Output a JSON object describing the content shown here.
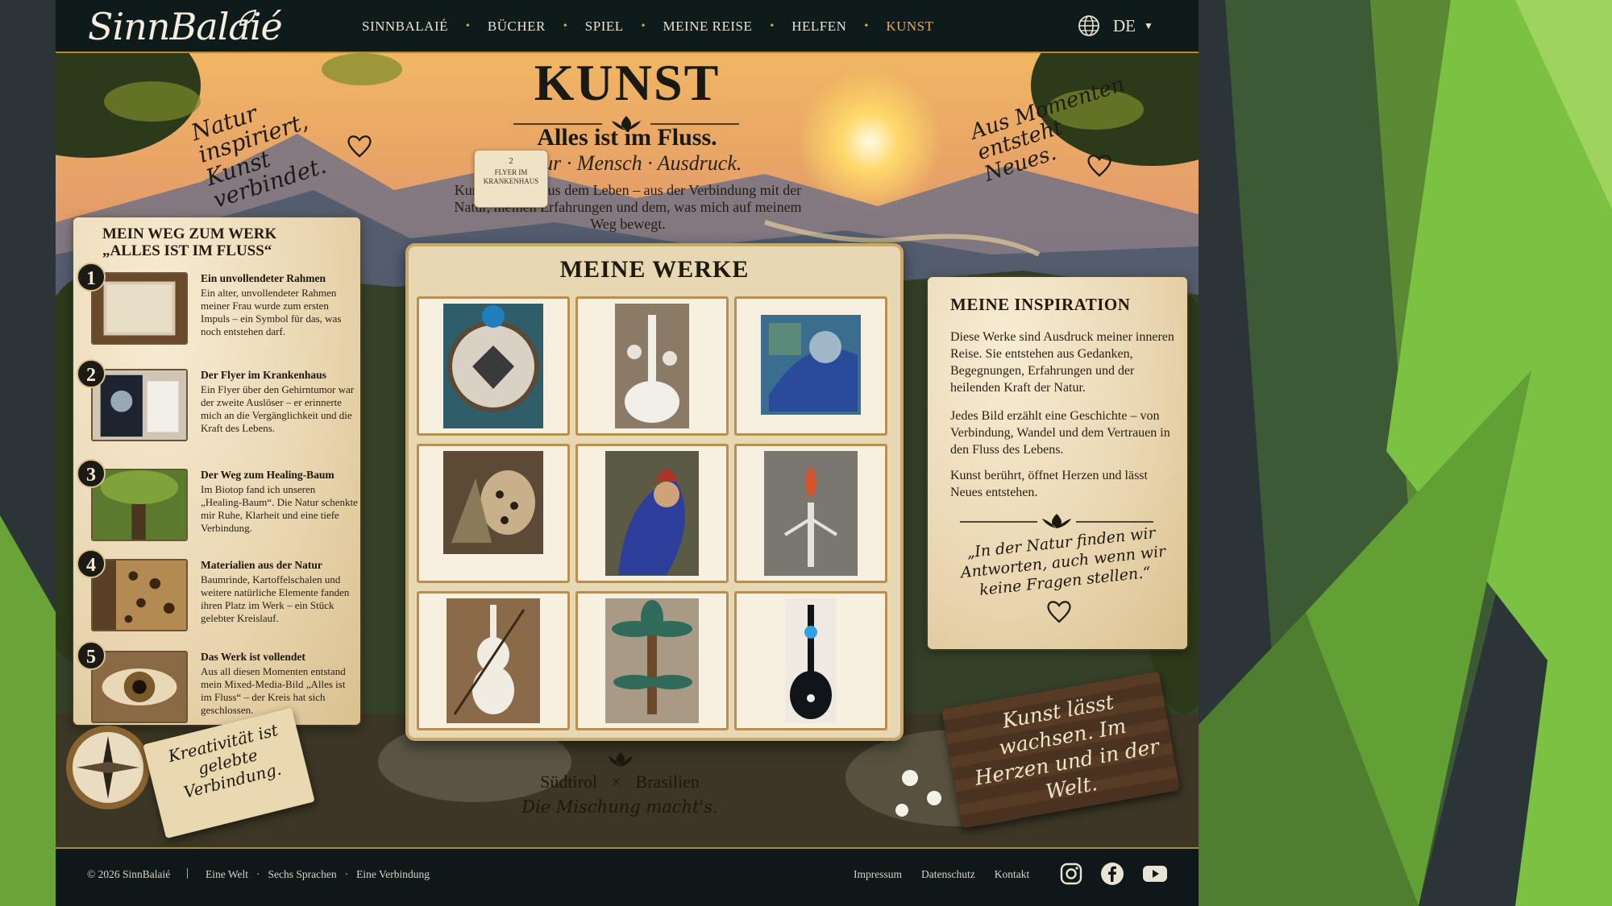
{
  "colors": {
    "nav_bg": "#0f1a1a",
    "accent": "#e2b04b",
    "slide_green": "#7bc142",
    "slide_dark": "#2b3538",
    "parchment": "#efe0c0"
  },
  "brand": {
    "logo_text": "SinnBalaié"
  },
  "nav": {
    "items": [
      {
        "label": "SINNBALAIÉ"
      },
      {
        "label": "BÜCHER"
      },
      {
        "label": "SPIEL"
      },
      {
        "label": "MEINE REISE"
      },
      {
        "label": "HELFEN"
      },
      {
        "label": "KUNST",
        "active": true
      }
    ]
  },
  "language": {
    "code": "DE",
    "icon": "globe-icon"
  },
  "hero": {
    "title": "KUNST",
    "subtitle": "Alles ist im Fluss.",
    "tagline": "Natur · Mensch · Ausdruck.",
    "text": "Kunst entsteht aus dem Leben – aus der Verbindung mit der Natur, meinen Erfahrungen und dem, was mich auf meinem Weg bewegt."
  },
  "notes": {
    "left": "Natur inspiriert, Kunst verbindet.",
    "right": "Aus Momenten entsteht Neues."
  },
  "sticky": {
    "number": "2",
    "text": "FLYER IM KRANKENHAUS"
  },
  "journey": {
    "title_line1": "MEIN WEG ZUM WERK",
    "title_line2": "„ALLES IST IM FLUSS“",
    "steps": [
      {
        "num": "1",
        "title": "Ein unvollendeter Rahmen",
        "text": "Ein alter, unvollendeter Rahmen meiner Frau wurde zum ersten Impuls – ein Symbol für das, was noch entstehen darf."
      },
      {
        "num": "2",
        "title": "Der Flyer im Krankenhaus",
        "text": "Ein Flyer über den Gehirntumor war der zweite Auslöser – er erinnerte mich an die Vergänglichkeit und die Kraft des Lebens."
      },
      {
        "num": "3",
        "title": "Der Weg zum Healing-Baum",
        "text": "Im Biotop fand ich unseren „Healing-Baum“. Die Natur schenkte mir Ruhe, Klarheit und eine tiefe Verbindung."
      },
      {
        "num": "4",
        "title": "Materialien aus der Natur",
        "text": "Baumrinde, Kartoffelschalen und weitere natürliche Elemente fanden ihren Platz im Werk – ein Stück gelebter Kreislauf."
      },
      {
        "num": "5",
        "title": "Das Werk ist vollendet",
        "text": "Aus all diesen Momenten entstand mein Mixed-Media-Bild „Alles ist im Fluss“ – der Kreis hat sich geschlossen."
      }
    ]
  },
  "gallery": {
    "title": "MEINE WERKE",
    "works": [
      {
        "name": "artwork-dreamcatcher-wolf"
      },
      {
        "name": "artwork-white-guitar"
      },
      {
        "name": "artwork-blue-painting"
      },
      {
        "name": "artwork-leopard-collage"
      },
      {
        "name": "artwork-blue-woman"
      },
      {
        "name": "artwork-flame-tree"
      },
      {
        "name": "artwork-white-violin"
      },
      {
        "name": "artwork-palm-sculpture"
      },
      {
        "name": "artwork-black-guitar"
      }
    ]
  },
  "inspiration": {
    "title": "MEINE INSPIRATION",
    "p1": "Diese Werke sind Ausdruck meiner inneren Reise. Sie entstehen aus Gedanken, Begegnungen, Erfahrungen und der heilenden Kraft der Natur.",
    "p2": "Jedes Bild erzählt eine Geschichte – von Verbindung, Wandel und dem Vertrauen in den Fluss des Lebens.",
    "p3": "Kunst berührt, öffnet Herzen und lässt Neues entstehen.",
    "quote": "„In der Natur finden wir Antworten, auch wenn wir keine Fragen stellen.“"
  },
  "sign": {
    "text": "Kunst lässt wachsen. Im Herzen und in der Welt."
  },
  "book": {
    "text": "Kreativität ist gelebte Verbindung."
  },
  "origin": {
    "left": "Südtirol",
    "x": "×",
    "right": "Brasilien",
    "mix": "Die Mischung macht's."
  },
  "footer": {
    "copyright": "© 2026 SinnBalaié",
    "separator": "|",
    "left_items": [
      "Eine Welt",
      "Sechs Sprachen",
      "Eine Verbindung"
    ],
    "right_items": [
      "Impressum",
      "Datenschutz",
      "Kontakt"
    ],
    "social": [
      "instagram-icon",
      "facebook-icon",
      "youtube-icon"
    ]
  }
}
